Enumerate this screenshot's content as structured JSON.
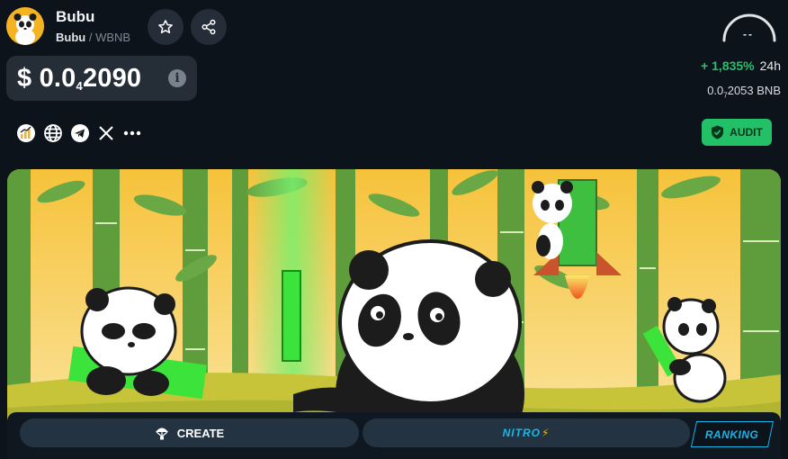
{
  "token": {
    "name": "Bubu",
    "symbol": "Bubu",
    "separator": "/",
    "pair": "WBNB"
  },
  "price": {
    "prefix": "$ 0.0",
    "zeros": "4",
    "digits": "2090"
  },
  "gauge": {
    "value": "--"
  },
  "change": {
    "percent": "+ 1,835%",
    "period": "24h"
  },
  "bnb_price": {
    "prefix": "0.0",
    "zeros": "7",
    "digits": "2053",
    "unit": "BNB"
  },
  "socials": [
    "chart-icon",
    "globe-icon",
    "telegram-icon",
    "x-icon",
    "more-icon"
  ],
  "audit": {
    "label": "AUDIT"
  },
  "actions": {
    "create_label": "CREATE",
    "nitro_label": "NITRO",
    "ranking_label": "RANKING"
  },
  "colors": {
    "background": "#0c131b",
    "accent_green": "#23c167",
    "positive": "#2ac06a",
    "nitro_blue": "#19b6e8",
    "logo_yellow": "#f3b322"
  }
}
